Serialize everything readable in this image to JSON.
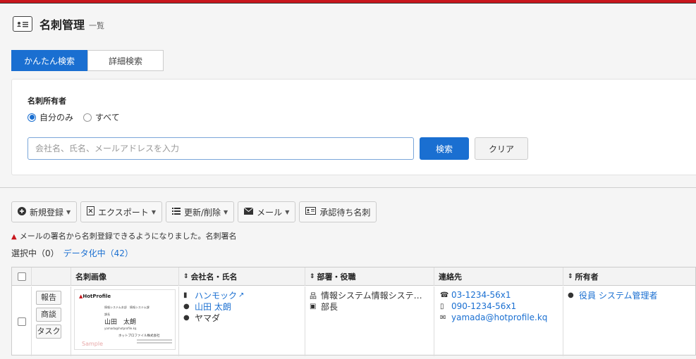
{
  "header": {
    "title": "名刺管理",
    "subtitle": "一覧"
  },
  "tabs": [
    {
      "label": "かんたん検索",
      "active": true
    },
    {
      "label": "詳細検索",
      "active": false
    }
  ],
  "search": {
    "owner_label": "名刺所有者",
    "options": [
      {
        "label": "自分のみ",
        "checked": true
      },
      {
        "label": "すべて",
        "checked": false
      }
    ],
    "placeholder": "会社名、氏名、メールアドレスを入力",
    "search_button": "検索",
    "clear_button": "クリア"
  },
  "toolbar": {
    "new": "新規登録",
    "export": "エクスポート",
    "update": "更新/削除",
    "mail": "メール",
    "pending": "承認待ち名刺"
  },
  "notice": "メールの署名から名刺登録できるようになりました。名刺署名",
  "selection": {
    "label": "選択中（0）",
    "link": "データ化中（42）"
  },
  "table": {
    "headers": {
      "image": "名刺画像",
      "company": "会社名・氏名",
      "dept": "部署・役職",
      "contact": "連絡先",
      "owner": "所有者"
    },
    "row": {
      "actions": [
        "報告",
        "商談",
        "タスク"
      ],
      "card": {
        "logo": "HotProfile",
        "dept_text": "情報システム本部　情報システム課",
        "role": "課長",
        "name": "山田　太朗",
        "email_small": "yamada@hotprofile.kq",
        "company_small": "ホットプロファイル株式会社",
        "sample": "Sample"
      },
      "company": "ハンモック",
      "name": "山田 太朗",
      "kana": "ヤマダ",
      "department": "情報システム情報システ…",
      "position": "部長",
      "phone": "03-1234-56x1",
      "mobile": "090-1234-56x1",
      "email": "yamada@hotprofile.kq",
      "owner": "役員 システム管理者"
    }
  },
  "colors": {
    "accent": "#1a6fd1",
    "brand": "#c8161d"
  }
}
